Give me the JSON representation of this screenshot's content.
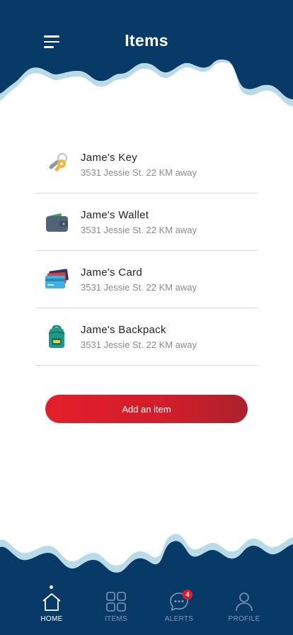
{
  "header": {
    "title": "Items"
  },
  "items": [
    {
      "name": "Jame's Key",
      "address": "3531 Jessie St. 22 KM away",
      "icon": "key-icon"
    },
    {
      "name": "Jame's Wallet",
      "address": "3531 Jessie St. 22 KM away",
      "icon": "wallet-icon"
    },
    {
      "name": "Jame's Card",
      "address": "3531 Jessie St. 22 KM away",
      "icon": "card-icon"
    },
    {
      "name": "Jame's Backpack",
      "address": "3531 Jessie St. 22 KM away",
      "icon": "backpack-icon"
    }
  ],
  "add_button": {
    "label": "Add an item"
  },
  "nav": {
    "home": "HOME",
    "items": "ITEMS",
    "alerts": "ALERTS",
    "alerts_badge": "4",
    "profile": "PROFILE"
  },
  "colors": {
    "navy": "#073a66",
    "wave_light": "#b9dbe8",
    "button_red": "#e31e2a",
    "badge_red": "#e21b2b"
  }
}
